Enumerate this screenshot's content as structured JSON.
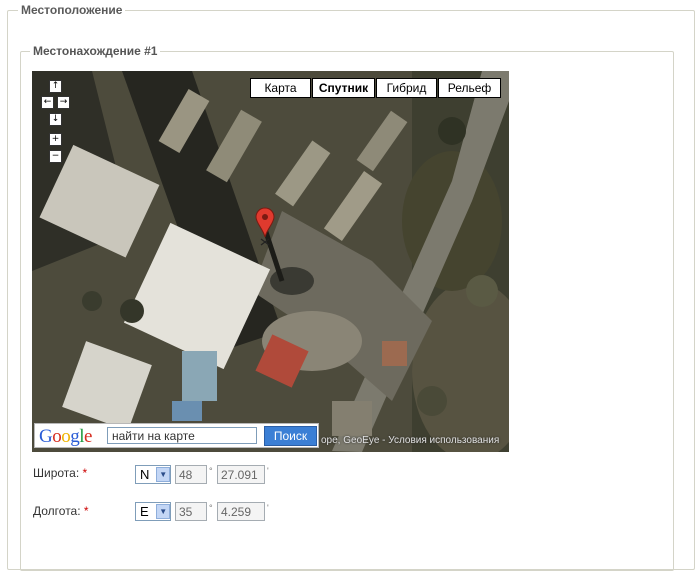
{
  "location_section": {
    "legend": "Местоположение"
  },
  "location_item": {
    "legend": "Местонахождение #1"
  },
  "map": {
    "type_buttons": [
      "Карта",
      "Спутник",
      "Гибрид",
      "Рельеф"
    ],
    "active_type": "Спутник",
    "pan": {
      "up": "↑",
      "left": "←",
      "right": "→",
      "down": "↓"
    },
    "zoom": {
      "in": "+",
      "out": "−"
    },
    "search": {
      "logo": "Google",
      "placeholder": "найти на карте",
      "button": "Поиск"
    },
    "copyright": "ope, GeoEye - Условия использования"
  },
  "latitude": {
    "label": "Широта:",
    "required": "*",
    "direction": "N",
    "degrees": "48",
    "degree_symbol": "°",
    "minutes": "27.091",
    "minute_symbol": "'"
  },
  "longitude": {
    "label": "Долгота:",
    "required": "*",
    "direction": "E",
    "degrees": "35",
    "degree_symbol": "°",
    "minutes": "4.259",
    "minute_symbol": "'"
  },
  "colors": {
    "search_button": "#3b7fd5",
    "required_marker": "#cc0000",
    "map_pin": "#e03a2e"
  }
}
